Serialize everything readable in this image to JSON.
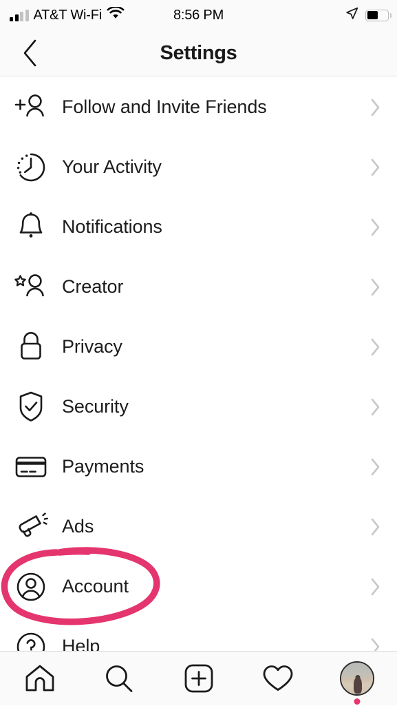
{
  "status_bar": {
    "carrier": "AT&T Wi-Fi",
    "time": "8:56 PM",
    "signal_icon": "cellular-bars-icon",
    "signal_bars_filled": 2,
    "signal_bars_total": 4,
    "wifi_icon": "wifi-icon",
    "location_icon": "location-arrow-icon",
    "battery_icon": "battery-icon",
    "battery_level_percent": 55
  },
  "header": {
    "title": "Settings",
    "back_icon": "chevron-left-icon"
  },
  "list": {
    "chevron_icon": "chevron-right-icon",
    "items": [
      {
        "label": "Follow and Invite Friends",
        "icon": "add-person-icon"
      },
      {
        "label": "Your Activity",
        "icon": "clock-activity-icon"
      },
      {
        "label": "Notifications",
        "icon": "bell-icon"
      },
      {
        "label": "Creator",
        "icon": "star-person-icon"
      },
      {
        "label": "Privacy",
        "icon": "lock-icon"
      },
      {
        "label": "Security",
        "icon": "shield-check-icon"
      },
      {
        "label": "Payments",
        "icon": "credit-card-icon"
      },
      {
        "label": "Ads",
        "icon": "megaphone-icon"
      },
      {
        "label": "Account",
        "icon": "user-circle-icon"
      },
      {
        "label": "Help",
        "icon": "question-circle-icon"
      }
    ]
  },
  "annotation": {
    "type": "hand-drawn-ellipse",
    "target_label": "Account",
    "color": "#E5356E"
  },
  "tab_bar": {
    "tabs": [
      {
        "name": "home",
        "icon": "home-icon"
      },
      {
        "name": "search",
        "icon": "search-icon"
      },
      {
        "name": "create",
        "icon": "plus-square-icon"
      },
      {
        "name": "activity",
        "icon": "heart-icon"
      },
      {
        "name": "profile",
        "icon": "profile-avatar"
      }
    ],
    "profile_badge_color": "#E8356D"
  },
  "colors": {
    "accent_pink": "#E5356E",
    "text_primary": "#1C1C1C",
    "chevron_gray": "#C7C7CC",
    "bg": "#FFFFFF",
    "chrome_bg": "#FAFAFA"
  }
}
